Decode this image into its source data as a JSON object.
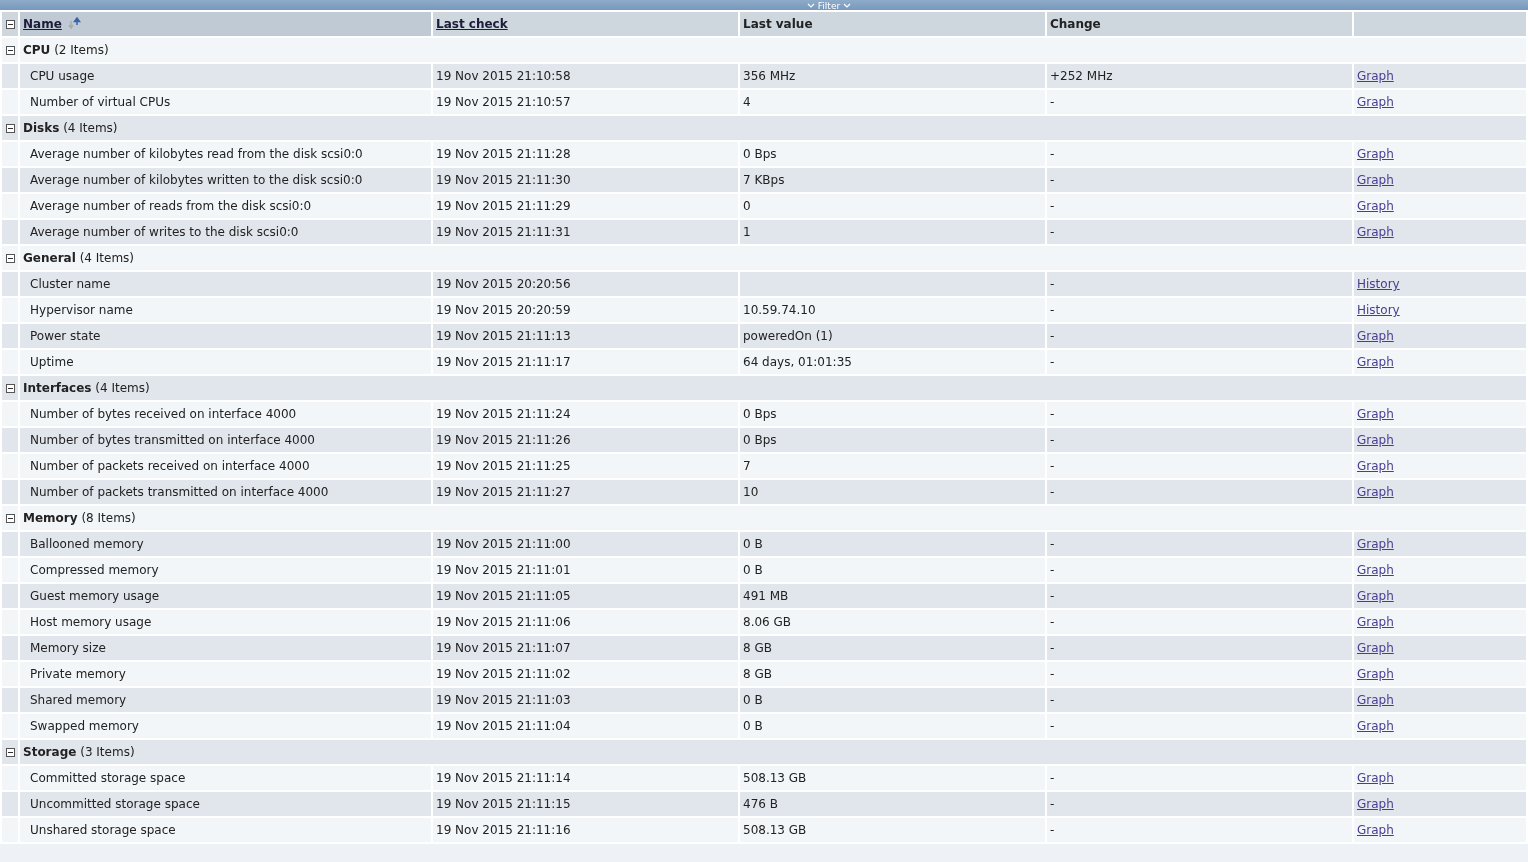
{
  "filter_bar": {
    "label": "Filter"
  },
  "columns": [
    {
      "label": "Name",
      "sortable": true,
      "sorted": true
    },
    {
      "label": "Last check",
      "sortable": true,
      "sorted": false
    },
    {
      "label": "Last value",
      "sortable": false,
      "sorted": false
    },
    {
      "label": "Change",
      "sortable": false,
      "sorted": false
    }
  ],
  "groups": [
    {
      "name": "CPU",
      "count": "(2 Items)",
      "expanded": true,
      "items": [
        {
          "name": "CPU usage",
          "last_check": "19 Nov 2015 21:10:58",
          "last_value": "356 MHz",
          "change": "+252 MHz",
          "link": "Graph"
        },
        {
          "name": "Number of virtual CPUs",
          "last_check": "19 Nov 2015 21:10:57",
          "last_value": "4",
          "change": "-",
          "link": "Graph"
        }
      ]
    },
    {
      "name": "Disks",
      "count": "(4 Items)",
      "expanded": true,
      "items": [
        {
          "name": "Average number of kilobytes read from the disk scsi0:0",
          "last_check": "19 Nov 2015 21:11:28",
          "last_value": "0 Bps",
          "change": "-",
          "link": "Graph"
        },
        {
          "name": "Average number of kilobytes written to the disk scsi0:0",
          "last_check": "19 Nov 2015 21:11:30",
          "last_value": "7 KBps",
          "change": "-",
          "link": "Graph"
        },
        {
          "name": "Average number of reads from the disk scsi0:0",
          "last_check": "19 Nov 2015 21:11:29",
          "last_value": "0",
          "change": "-",
          "link": "Graph"
        },
        {
          "name": "Average number of writes to the disk scsi0:0",
          "last_check": "19 Nov 2015 21:11:31",
          "last_value": "1",
          "change": "-",
          "link": "Graph"
        }
      ]
    },
    {
      "name": "General",
      "count": "(4 Items)",
      "expanded": true,
      "items": [
        {
          "name": "Cluster name",
          "last_check": "19 Nov 2015 20:20:56",
          "change": "-",
          "link": "History"
        },
        {
          "name": "Hypervisor name",
          "last_check": "19 Nov 2015 20:20:59",
          "last_value": "10.59.74.10",
          "change": "-",
          "link": "History"
        },
        {
          "name": "Power state",
          "last_check": "19 Nov 2015 21:11:13",
          "last_value": "poweredOn (1)",
          "change": "-",
          "link": "Graph"
        },
        {
          "name": "Uptime",
          "last_check": "19 Nov 2015 21:11:17",
          "last_value": "64 days, 01:01:35",
          "change": "-",
          "link": "Graph"
        }
      ]
    },
    {
      "name": "Interfaces",
      "count": "(4 Items)",
      "expanded": true,
      "items": [
        {
          "name": "Number of bytes received on interface 4000",
          "last_check": "19 Nov 2015 21:11:24",
          "last_value": "0 Bps",
          "change": "-",
          "link": "Graph"
        },
        {
          "name": "Number of bytes transmitted on interface 4000",
          "last_check": "19 Nov 2015 21:11:26",
          "last_value": "0 Bps",
          "change": "-",
          "link": "Graph"
        },
        {
          "name": "Number of packets received on interface 4000",
          "last_check": "19 Nov 2015 21:11:25",
          "last_value": "7",
          "change": "-",
          "link": "Graph"
        },
        {
          "name": "Number of packets transmitted on interface 4000",
          "last_check": "19 Nov 2015 21:11:27",
          "last_value": "10",
          "change": "-",
          "link": "Graph"
        }
      ]
    },
    {
      "name": "Memory",
      "count": "(8 Items)",
      "expanded": true,
      "items": [
        {
          "name": "Ballooned memory",
          "last_check": "19 Nov 2015 21:11:00",
          "last_value": "0 B",
          "change": "-",
          "link": "Graph"
        },
        {
          "name": "Compressed memory",
          "last_check": "19 Nov 2015 21:11:01",
          "last_value": "0 B",
          "change": "-",
          "link": "Graph"
        },
        {
          "name": "Guest memory usage",
          "last_check": "19 Nov 2015 21:11:05",
          "last_value": "491 MB",
          "change": "-",
          "link": "Graph"
        },
        {
          "name": "Host memory usage",
          "last_check": "19 Nov 2015 21:11:06",
          "last_value": "8.06 GB",
          "change": "-",
          "link": "Graph"
        },
        {
          "name": "Memory size",
          "last_check": "19 Nov 2015 21:11:07",
          "last_value": "8 GB",
          "change": "-",
          "link": "Graph"
        },
        {
          "name": "Private memory",
          "last_check": "19 Nov 2015 21:11:02",
          "last_value": "8 GB",
          "change": "-",
          "link": "Graph"
        },
        {
          "name": "Shared memory",
          "last_check": "19 Nov 2015 21:11:03",
          "last_value": "0 B",
          "change": "-",
          "link": "Graph"
        },
        {
          "name": "Swapped memory",
          "last_check": "19 Nov 2015 21:11:04",
          "last_value": "0 B",
          "change": "-",
          "link": "Graph"
        }
      ]
    },
    {
      "name": "Storage",
      "count": "(3 Items)",
      "expanded": true,
      "items": [
        {
          "name": "Committed storage space",
          "last_check": "19 Nov 2015 21:11:14",
          "last_value": "508.13 GB",
          "change": "-",
          "link": "Graph"
        },
        {
          "name": "Uncommitted storage space",
          "last_check": "19 Nov 2015 21:11:15",
          "last_value": "476 B",
          "change": "-",
          "link": "Graph"
        },
        {
          "name": "Unshared storage space",
          "last_check": "19 Nov 2015 21:11:16",
          "last_value": "508.13 GB",
          "change": "-",
          "link": "Graph"
        }
      ]
    }
  ]
}
